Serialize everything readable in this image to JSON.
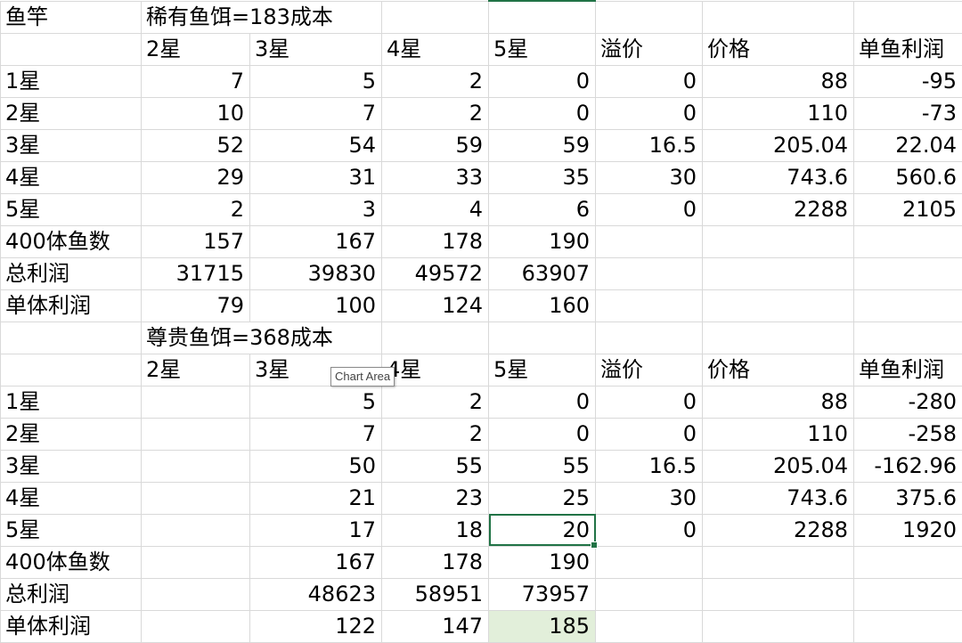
{
  "section1": {
    "header": [
      "鱼竿",
      "稀有鱼饵=183成本",
      "",
      "",
      "",
      "",
      ""
    ],
    "cols": [
      "",
      "2星",
      "3星",
      "4星",
      "5星",
      "溢价",
      "价格",
      "单鱼利润"
    ],
    "rows": [
      [
        "1星",
        "7",
        "5",
        "2",
        "0",
        "0",
        "88",
        "-95"
      ],
      [
        "2星",
        "10",
        "7",
        "2",
        "0",
        "0",
        "110",
        "-73"
      ],
      [
        "3星",
        "52",
        "54",
        "59",
        "59",
        "16.5",
        "205.04",
        "22.04"
      ],
      [
        "4星",
        "29",
        "31",
        "33",
        "35",
        "30",
        "743.6",
        "560.6"
      ],
      [
        "5星",
        "2",
        "3",
        "4",
        "6",
        "0",
        "2288",
        "2105"
      ],
      [
        "400体鱼数",
        "157",
        "167",
        "178",
        "190",
        "",
        "",
        ""
      ],
      [
        "总利润",
        "31715",
        "39830",
        "49572",
        "63907",
        "",
        "",
        ""
      ],
      [
        "单体利润",
        "79",
        "100",
        "124",
        "160",
        "",
        "",
        ""
      ]
    ]
  },
  "section2": {
    "header": [
      "",
      "尊贵鱼饵=368成本",
      "",
      "",
      "",
      "",
      ""
    ],
    "cols": [
      "",
      "2星",
      "3星",
      "4星",
      "5星",
      "溢价",
      "价格",
      "单鱼利润"
    ],
    "rows": [
      [
        "1星",
        "",
        "5",
        "2",
        "0",
        "0",
        "88",
        "-280"
      ],
      [
        "2星",
        "",
        "7",
        "2",
        "0",
        "0",
        "110",
        "-258"
      ],
      [
        "3星",
        "",
        "50",
        "55",
        "55",
        "16.5",
        "205.04",
        "-162.96"
      ],
      [
        "4星",
        "",
        "21",
        "23",
        "25",
        "30",
        "743.6",
        "375.6"
      ],
      [
        "5星",
        "",
        "17",
        "18",
        "20",
        "0",
        "2288",
        "1920"
      ],
      [
        "400体鱼数",
        "",
        "167",
        "178",
        "190",
        "",
        "",
        ""
      ],
      [
        "总利润",
        "",
        "48623",
        "58951",
        "73957",
        "",
        "",
        ""
      ],
      [
        "单体利润",
        "",
        "122",
        "147",
        "185",
        "",
        "",
        ""
      ]
    ]
  },
  "tooltip": {
    "text": "Chart Area"
  },
  "colors": {
    "selection": "#217346",
    "highlight": "#e2efda",
    "gridline": "#d9d9d9"
  }
}
